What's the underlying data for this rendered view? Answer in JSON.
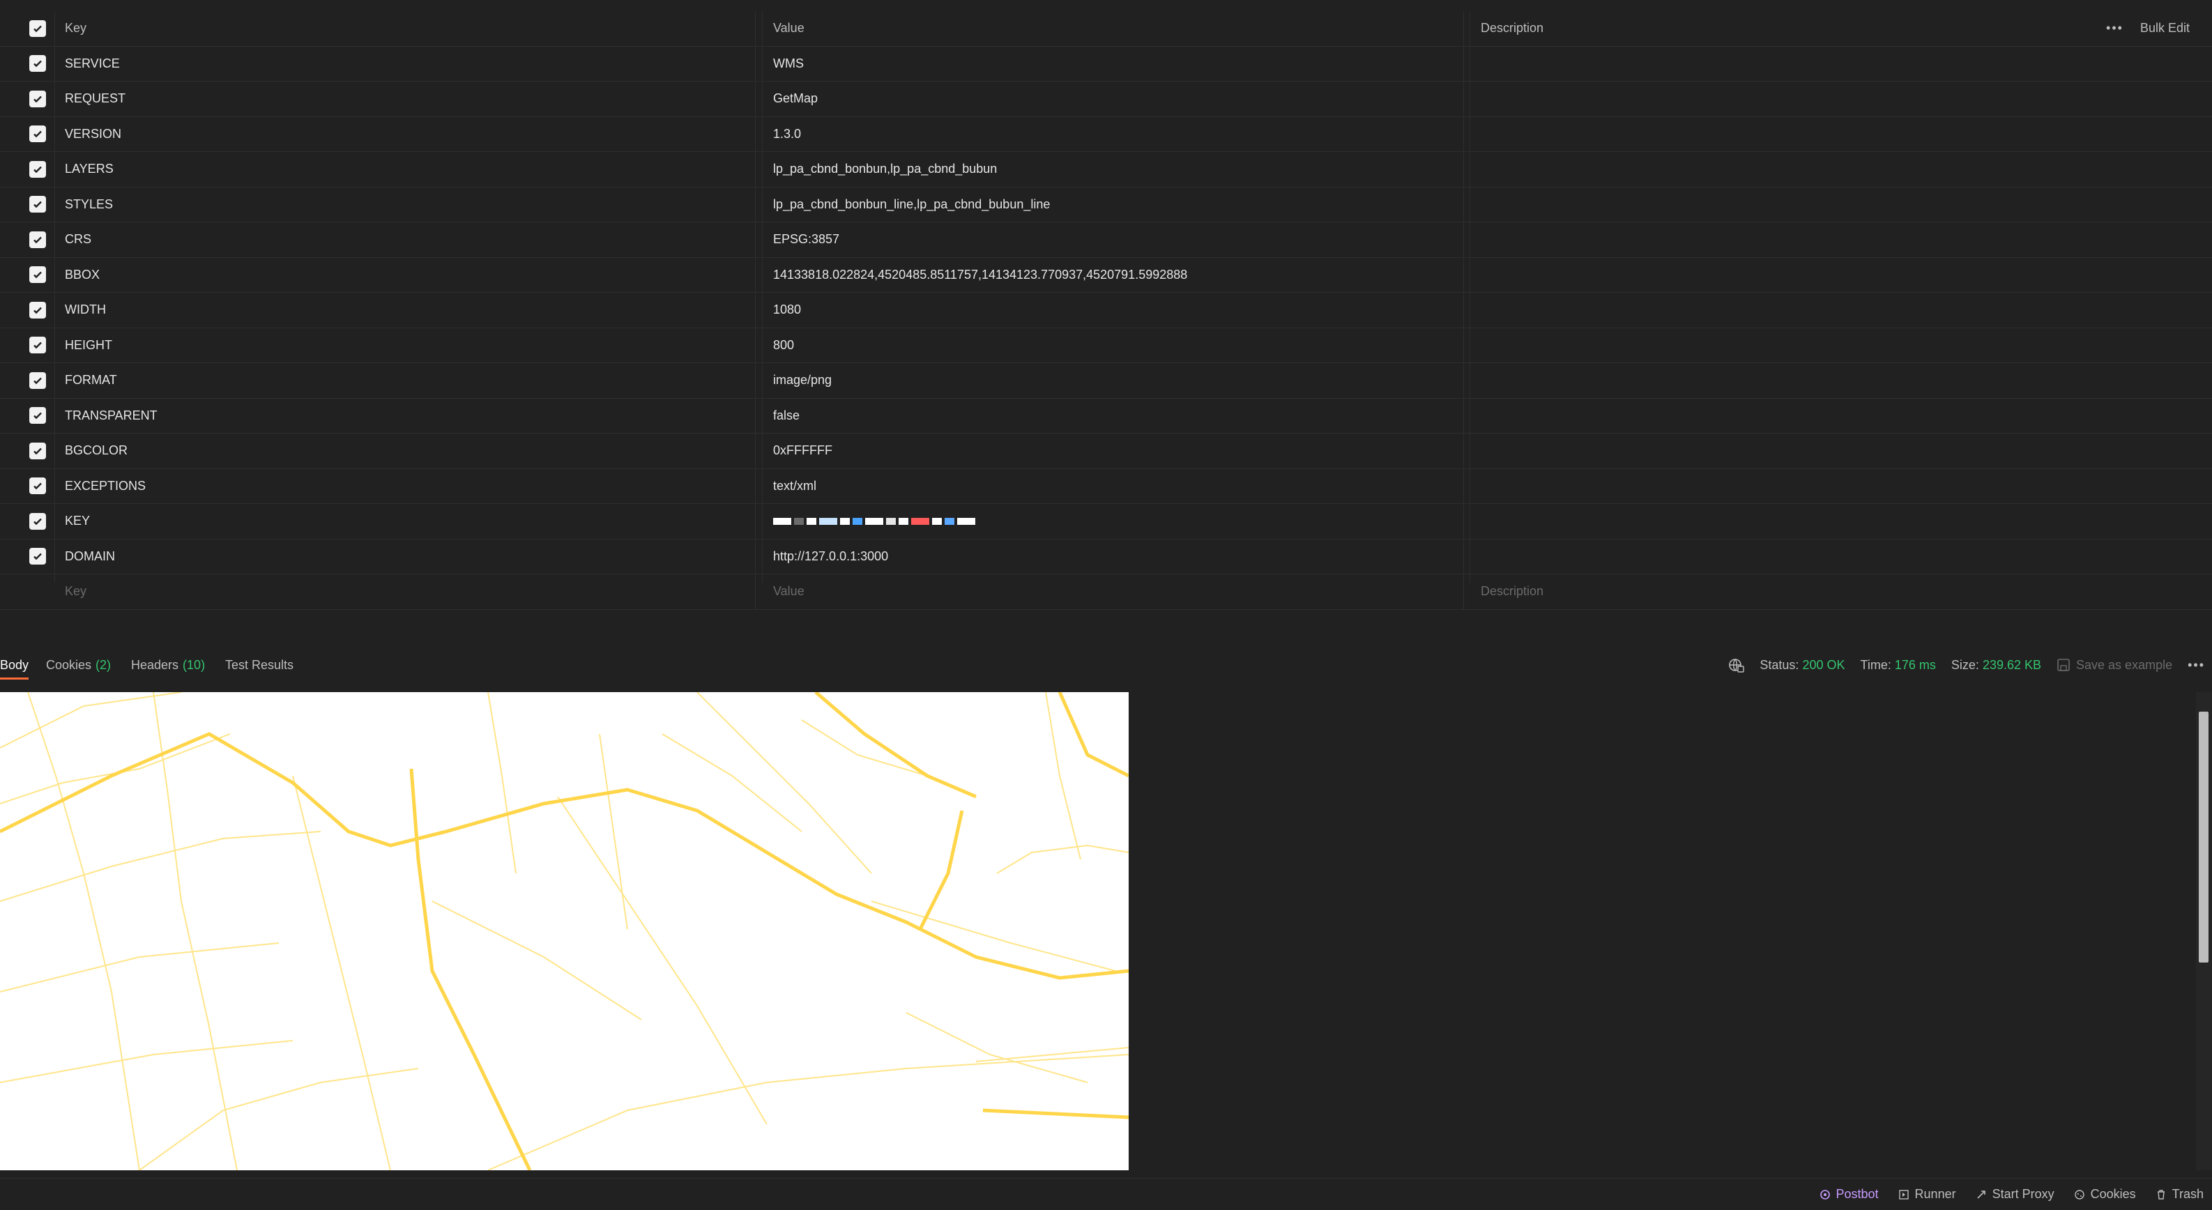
{
  "params_table": {
    "headers": {
      "key": "Key",
      "value": "Value",
      "description": "Description"
    },
    "bulk_edit_label": "Bulk Edit",
    "rows": [
      {
        "key": "SERVICE",
        "value": "WMS"
      },
      {
        "key": "REQUEST",
        "value": "GetMap"
      },
      {
        "key": "VERSION",
        "value": "1.3.0"
      },
      {
        "key": "LAYERS",
        "value": "lp_pa_cbnd_bonbun,lp_pa_cbnd_bubun"
      },
      {
        "key": "STYLES",
        "value": "lp_pa_cbnd_bonbun_line,lp_pa_cbnd_bubun_line"
      },
      {
        "key": "CRS",
        "value": "EPSG:3857"
      },
      {
        "key": "BBOX",
        "value": "14133818.022824,4520485.8511757,14134123.770937,4520791.5992888"
      },
      {
        "key": "WIDTH",
        "value": "1080"
      },
      {
        "key": "HEIGHT",
        "value": "800"
      },
      {
        "key": "FORMAT",
        "value": "image/png"
      },
      {
        "key": "TRANSPARENT",
        "value": "false"
      },
      {
        "key": "BGCOLOR",
        "value": "0xFFFFFF"
      },
      {
        "key": "EXCEPTIONS",
        "value": "text/xml"
      },
      {
        "key": "KEY",
        "value": ""
      },
      {
        "key": "DOMAIN",
        "value": "http://127.0.0.1:3000"
      }
    ],
    "new_row": {
      "key_placeholder": "Key",
      "value_placeholder": "Value",
      "description_placeholder": "Description"
    }
  },
  "response": {
    "tabs": [
      {
        "label": "Body",
        "count": ""
      },
      {
        "label": "Cookies",
        "count": "(2)"
      },
      {
        "label": "Headers",
        "count": "(10)"
      },
      {
        "label": "Test Results",
        "count": ""
      }
    ],
    "status_label": "Status:",
    "status_value": "200 OK",
    "time_label": "Time:",
    "time_value": "176 ms",
    "size_label": "Size:",
    "size_value": "239.62 KB",
    "save_example_label": "Save as example"
  },
  "bottom_bar": {
    "postbot": "Postbot",
    "runner": "Runner",
    "start_proxy": "Start Proxy",
    "cookies": "Cookies",
    "trash": "Trash"
  },
  "colors": {
    "background": "#212121",
    "accent_tab": "#ff6c37",
    "status_green": "#35c46e",
    "map_line": "#ffd54a"
  }
}
